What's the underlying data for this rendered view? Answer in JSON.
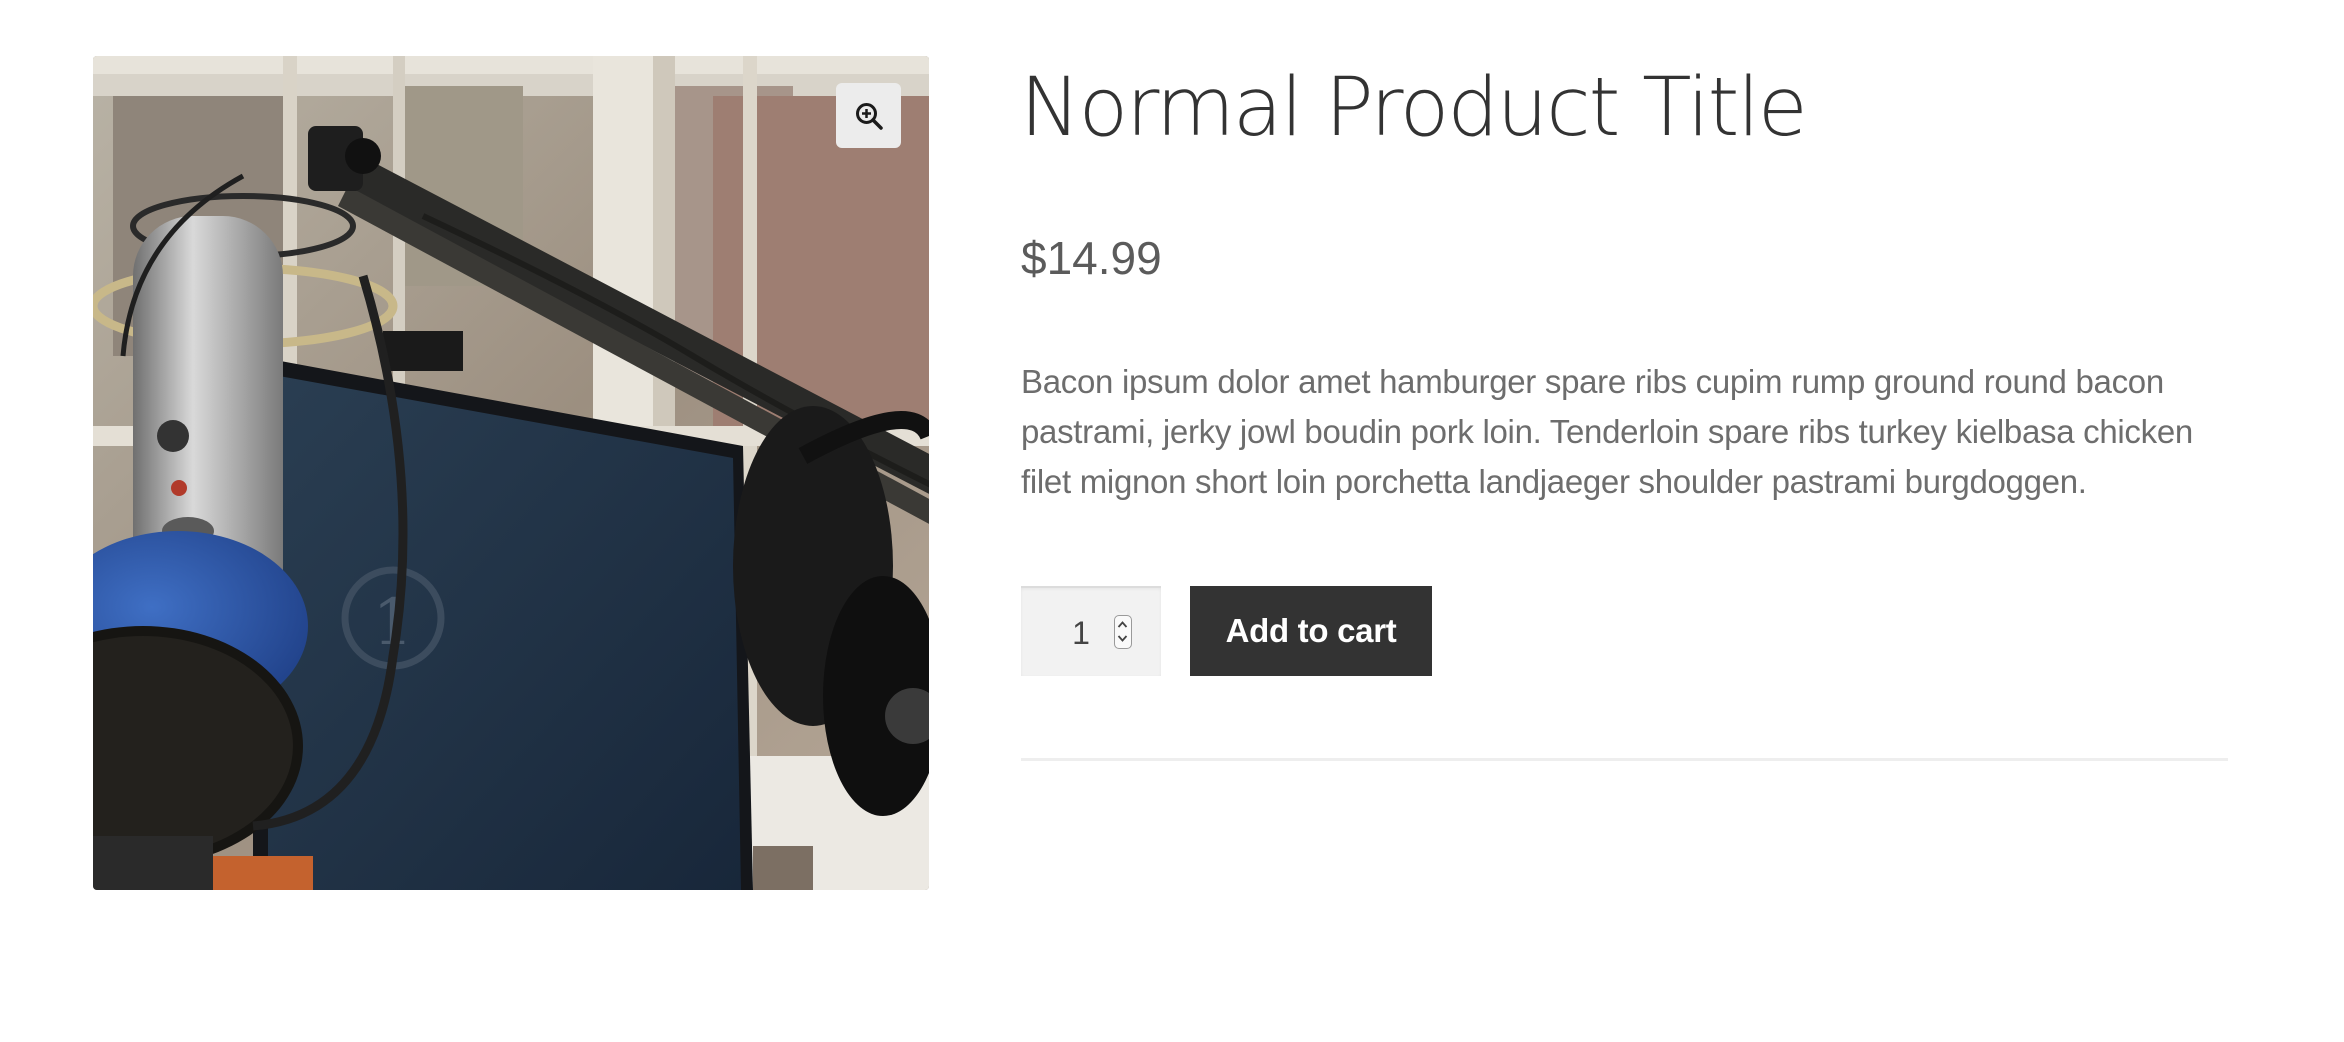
{
  "product": {
    "title": "Normal Product Title",
    "price": "$14.99",
    "description": "Bacon ipsum dolor amet hamburger spare ribs cupim rump ground round bacon pastrami, jerky jowl boudin pork loin. Tenderloin spare ribs turkey kielbasa chicken filet mignon short loin porchetta landjaeger shoulder pastrami burgdoggen.",
    "image_alt": "Microphone on boom arm with headphones in front of a monitor"
  },
  "gallery": {
    "zoom_icon": "zoom-in-icon",
    "monitor_screen_text": "1"
  },
  "cart": {
    "quantity": "1",
    "add_to_cart_label": "Add to cart"
  },
  "colors": {
    "button_bg": "#333333",
    "title_color": "#333333",
    "text_color": "#6d6d6d",
    "qty_bg": "#f2f2f2"
  }
}
